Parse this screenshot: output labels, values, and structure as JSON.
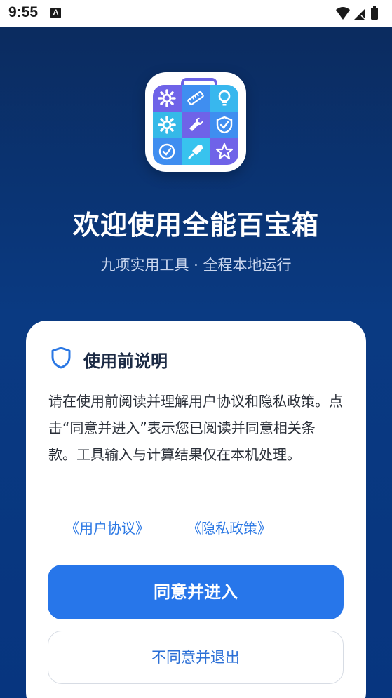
{
  "status_bar": {
    "time": "9:55",
    "notification_icon": "A",
    "icons": [
      "wifi-icon",
      "signal-icon",
      "battery-icon"
    ]
  },
  "app": {
    "icon_tiles": [
      {
        "icon": "gear-icon",
        "color": "#6f63e8"
      },
      {
        "icon": "ruler-icon",
        "color": "#3f8ef0"
      },
      {
        "icon": "lightbulb-icon",
        "color": "#38b7ee"
      },
      {
        "icon": "settings-icon",
        "color": "#35b9e8"
      },
      {
        "icon": "wrench-icon",
        "color": "#6f63e8"
      },
      {
        "icon": "shield-check-icon",
        "color": "#3f8ef0"
      },
      {
        "icon": "check-circle-icon",
        "color": "#3f8ef0"
      },
      {
        "icon": "rocket-icon",
        "color": "#38c3ee"
      },
      {
        "icon": "star-icon",
        "color": "#6f63e8"
      }
    ],
    "title": "欢迎使用全能百宝箱",
    "subtitle": "九项实用工具 · 全程本地运行"
  },
  "card": {
    "title": "使用前说明",
    "body": "请在使用前阅读并理解用户协议和隐私政策。点击“同意并进入”表示您已阅读并同意相关条款。工具输入与计算结果仅在本机处理。",
    "link_user_agreement": "《用户协议》",
    "link_privacy_policy": "《隐私政策》",
    "agree_button": "同意并进入",
    "disagree_button": "不同意并退出"
  },
  "colors": {
    "background": "#0a3a82",
    "primary": "#2776ea",
    "link": "#2b78e4"
  }
}
